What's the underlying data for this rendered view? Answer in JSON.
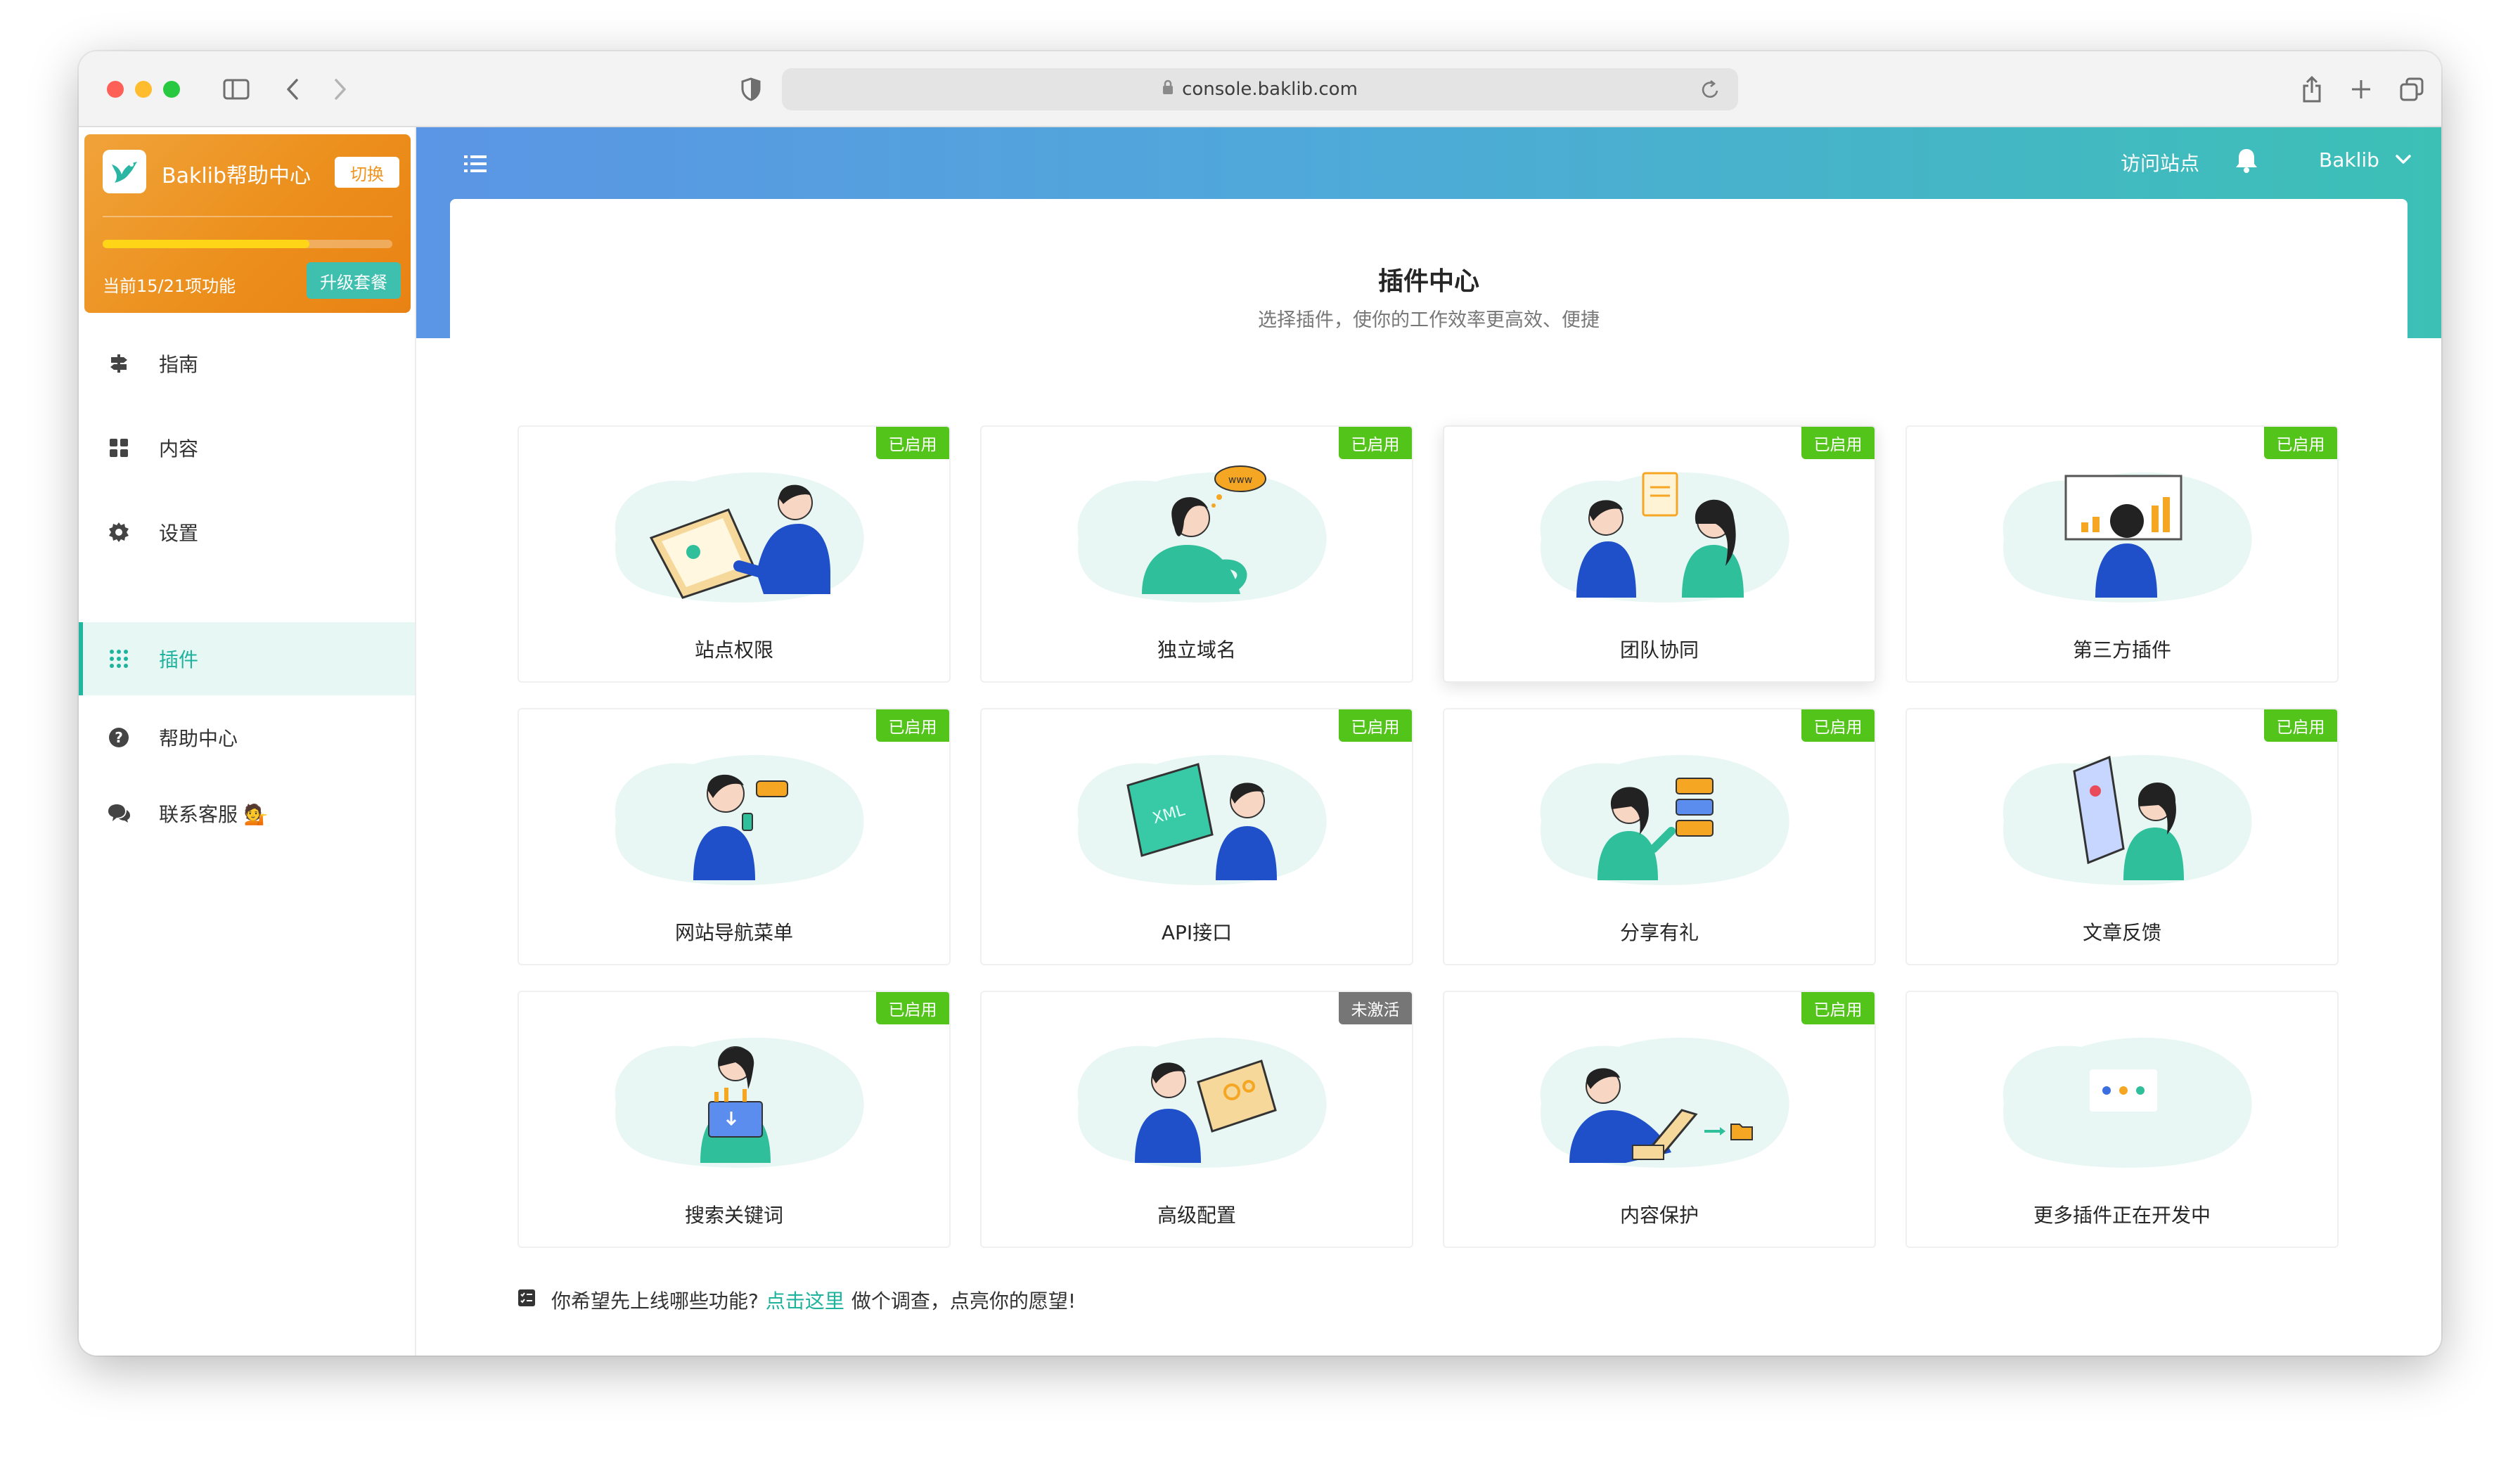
{
  "browser": {
    "url": "console.baklib.com"
  },
  "sidebar": {
    "brand": {
      "name": "Baklib帮助中心",
      "switch_label": "切换",
      "progress": 0.714,
      "count_text": "当前15/21项功能",
      "upgrade_label": "升级套餐"
    },
    "items": [
      {
        "label": "指南",
        "icon": "signpost-icon"
      },
      {
        "label": "内容",
        "icon": "grid-icon"
      },
      {
        "label": "设置",
        "icon": "gear-icon"
      },
      {
        "label": "插件",
        "icon": "dots-grid-icon",
        "active": true
      },
      {
        "label": "帮助中心",
        "icon": "question-icon"
      },
      {
        "label": "联系客服 💁",
        "icon": "chat-icon"
      }
    ]
  },
  "header": {
    "visit_label": "访问站点",
    "user_name": "Baklib"
  },
  "panel": {
    "title": "插件中心",
    "subtitle": "选择插件，使你的工作效率更高效、便捷"
  },
  "plugins": [
    {
      "label": "站点权限",
      "badge": "已启用",
      "status": "enabled"
    },
    {
      "label": "独立域名",
      "badge": "已启用",
      "status": "enabled"
    },
    {
      "label": "团队协同",
      "badge": "已启用",
      "status": "enabled"
    },
    {
      "label": "第三方插件",
      "badge": "已启用",
      "status": "enabled"
    },
    {
      "label": "网站导航菜单",
      "badge": "已启用",
      "status": "enabled"
    },
    {
      "label": "API接口",
      "badge": "已启用",
      "status": "enabled"
    },
    {
      "label": "分享有礼",
      "badge": "已启用",
      "status": "enabled"
    },
    {
      "label": "文章反馈",
      "badge": "已启用",
      "status": "enabled"
    },
    {
      "label": "搜索关键词",
      "badge": "已启用",
      "status": "enabled"
    },
    {
      "label": "高级配置",
      "badge": "未激活",
      "status": "inactive"
    },
    {
      "label": "内容保护",
      "badge": "已启用",
      "status": "enabled"
    },
    {
      "label": "更多插件正在开发中",
      "badge": "",
      "status": "none"
    }
  ],
  "survey": {
    "prefix": "你希望先上线哪些功能?",
    "link": "点击这里",
    "suffix": "做个调查，点亮你的愿望!"
  },
  "colors": {
    "accent": "#1fb39e",
    "brand_orange": "#ec8f1c",
    "badge_enabled": "#52c41a",
    "badge_inactive": "#767676",
    "illus_blue": "#1f4fc9",
    "illus_teal": "#2fbf9b"
  }
}
